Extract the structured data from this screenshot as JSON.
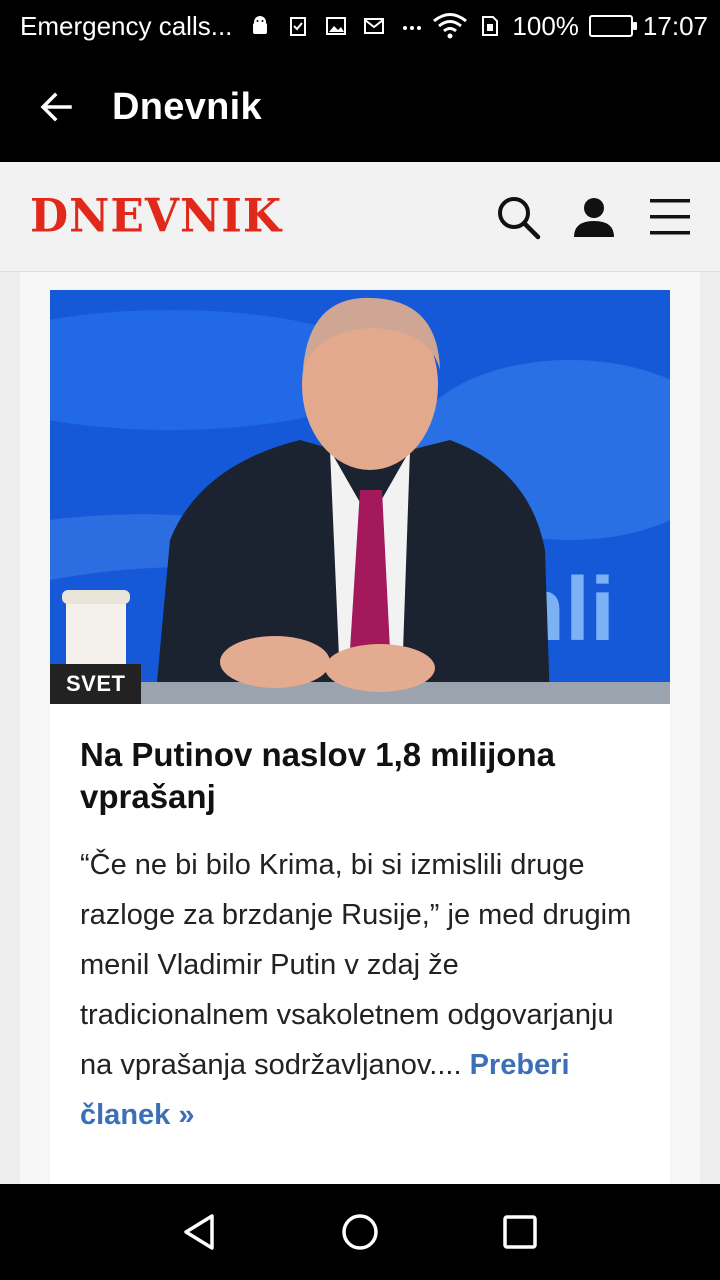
{
  "status_bar": {
    "carrier": "Emergency calls...",
    "battery": "100%",
    "time": "17:07",
    "icons": [
      "android-icon",
      "clipboard-check-icon",
      "image-icon",
      "mail-icon",
      "more-dots-icon",
      "wifi-icon",
      "sim-icon",
      "battery-icon"
    ]
  },
  "app_bar": {
    "title": "Dnevnik",
    "back_icon": "arrow-back-icon"
  },
  "web_header": {
    "logo": "DNEVNIK",
    "logo_color": "#e0291b",
    "icons": [
      "search-icon",
      "user-icon",
      "menu-icon"
    ]
  },
  "article": {
    "category": "SVET",
    "headline": "Na Putinov naslov 1,8 milijona vprašanj",
    "excerpt": "“Če ne bi bilo Krima, bi si izmislili druge razloge za brzdanje Rusije,” je med drugim menil Vladimir Putin v zdaj že tradicionalnem vsakoletnem odgovarjanju na vprašanja sodržavljanov....",
    "read_more": "Preberi članek »",
    "link_color": "#3c6fb6"
  },
  "nav_bar": {
    "icons": [
      "back-triangle-icon",
      "home-circle-icon",
      "recents-square-icon"
    ]
  }
}
